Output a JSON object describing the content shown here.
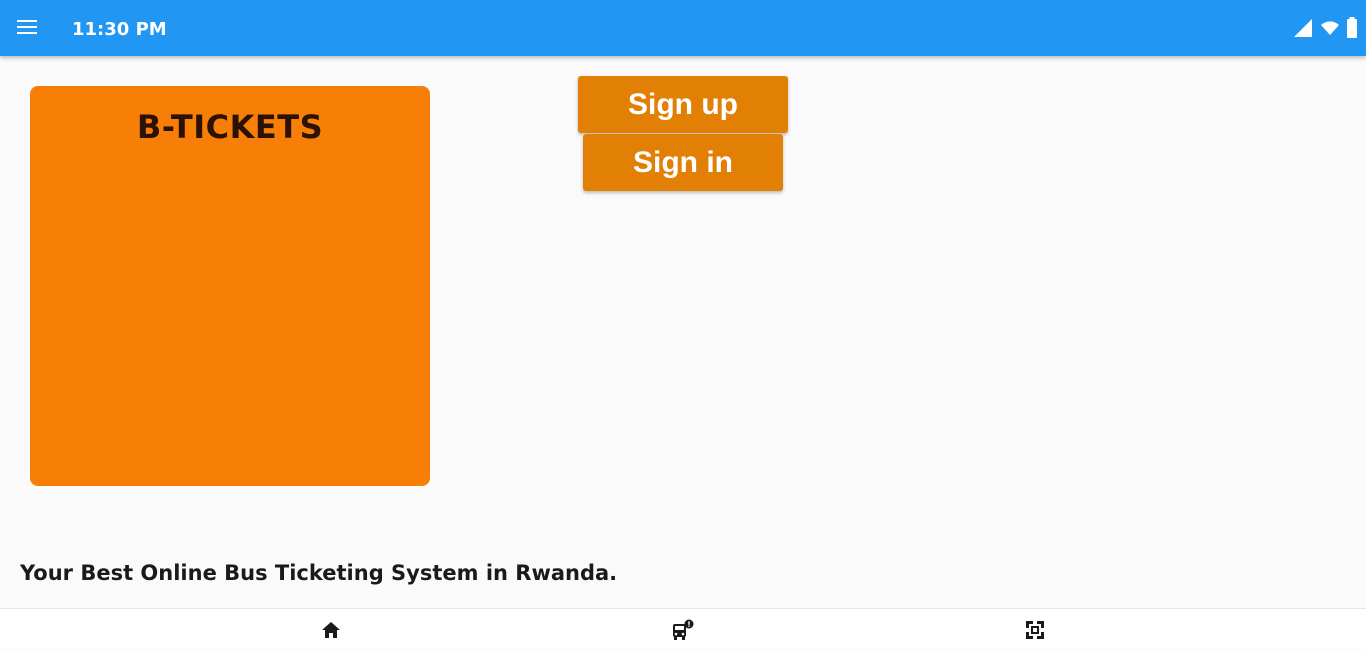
{
  "status_bar": {
    "time": "11:30 PM",
    "background_color": "#2196f3",
    "icons": [
      "menu-icon",
      "signal-icon",
      "wifi-icon",
      "battery-icon"
    ]
  },
  "brand": {
    "title": "B-TICKETS",
    "card_color": "#f87f07"
  },
  "actions": {
    "signup_label": "Sign up",
    "signin_label": "Sign in",
    "button_color": "#e27f05"
  },
  "tagline": "Your Best Online Bus Ticketing System in Rwanda.",
  "bottom_nav": {
    "items": [
      {
        "icon": "home-icon"
      },
      {
        "icon": "bus-alert-icon"
      },
      {
        "icon": "scan-icon"
      }
    ]
  }
}
